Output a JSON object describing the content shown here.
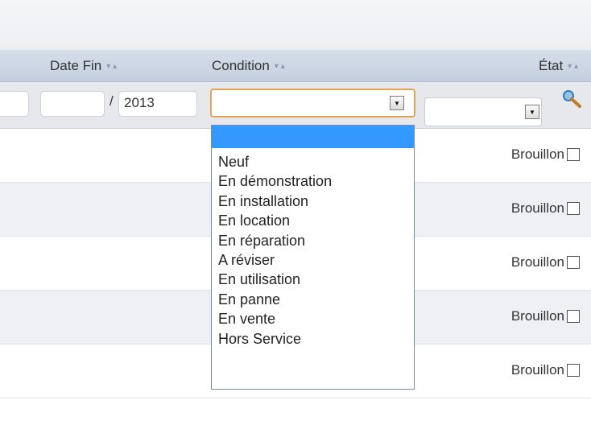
{
  "columns": {
    "date_fin": "Date Fin",
    "condition": "Condition",
    "etat": "État"
  },
  "filters": {
    "year_separator": "/",
    "year_value": "2013"
  },
  "dropdown": {
    "selected": "",
    "options": [
      "",
      "Neuf",
      "En démonstration",
      "En installation",
      "En location",
      "En réparation",
      "A réviser",
      "En utilisation",
      "En panne",
      "En vente",
      "Hors Service"
    ]
  },
  "rows": [
    {
      "etat": "Brouillon"
    },
    {
      "etat": "Brouillon"
    },
    {
      "etat": "Brouillon"
    },
    {
      "etat": "Brouillon"
    },
    {
      "etat": "Brouillon"
    }
  ],
  "icons": {
    "sort": "sort-arrows-icon",
    "dropdown": "chevron-down-icon",
    "search": "search-icon"
  },
  "colors": {
    "focus_border": "#e3a45a",
    "selection": "#3399ff",
    "header_bg": "#c9d3e2"
  }
}
